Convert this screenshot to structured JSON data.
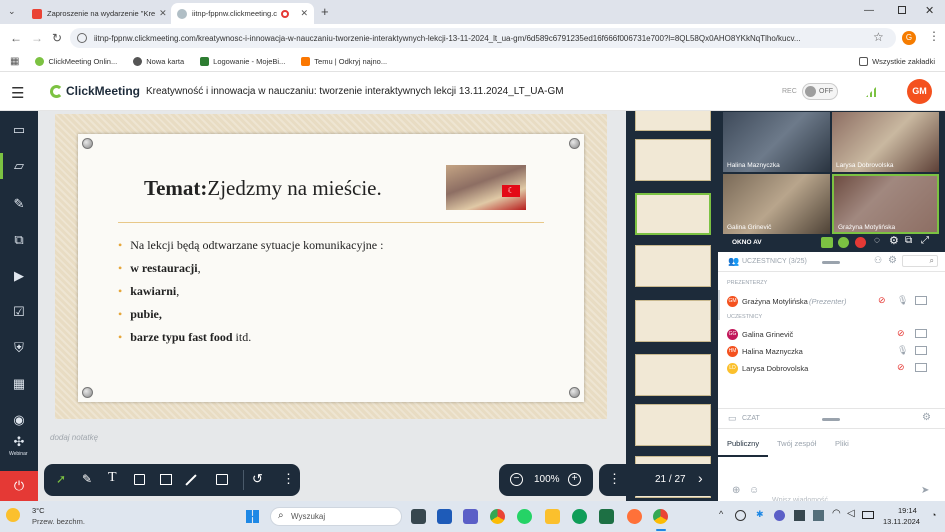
{
  "browser": {
    "tabs": [
      {
        "label": "Zaproszenie na wydarzenie \"Kre",
        "active": false
      },
      {
        "label": "iitnp-fppnw.clickmeeting.c",
        "active": true
      }
    ],
    "url": "iitnp-fppnw.clickmeeting.com/kreatywnosc-i-innowacja-w-nauczaniu-tworzenie-interaktywnych-lekcji-13-11-2024_lt_ua-gm/6d589c6791235ed16f666f006731e700?l=8QL58Qx0AHO8YKkNqTlho/kucv...",
    "bookmarks": [
      "ClickMeeting Onlin...",
      "Nowa karta",
      "Logowanie - MojeBi...",
      "Temu | Odkryj najno..."
    ],
    "all_bookmarks": "Wszystkie zakładki",
    "profile_initial": "G"
  },
  "app": {
    "logo": "ClickMeeting",
    "title": "Kreatywność i innowacja w nauczaniu: tworzenie interaktywnych lekcji 13.11.2024_LT_UA-GM",
    "rec_label": "REC",
    "rec_toggle": "OFF",
    "avatar": "GM"
  },
  "rail": {
    "webinar_label": "Webinar"
  },
  "slide": {
    "title_bold": "Temat:",
    "title_rest": "Zjedzmy na mieście.",
    "intro": "Na lekcji będą odtwarzane sytuacje komunikacyjne :",
    "items": [
      {
        "bold": "w restauracji",
        "rest": ","
      },
      {
        "bold": "kawiarni",
        "rest": ","
      },
      {
        "bold": "pubie,",
        "rest": ""
      },
      {
        "bold": "barze typu fast food",
        "rest": " itd."
      }
    ]
  },
  "notes_placeholder": "dodaj notatkę",
  "toolbar": {
    "zoom": "100%",
    "page": "21 / 27"
  },
  "video": {
    "tiles": [
      "Halina Maznyczka",
      "Larysa Dobrovolska",
      "Galina Grinevič",
      "Grażyna Motylińska"
    ],
    "section_label": "OKNO AV"
  },
  "participants": {
    "header": "UCZESTNICY (3/25)",
    "presenters_label": "PREZENTERZY",
    "participants_label": "UCZESTNICY",
    "presenter": {
      "initials": "GM",
      "name": "Grażyna Motylińska",
      "role": "(Prezenter)"
    },
    "list": [
      {
        "initials": "GG",
        "name": "Galina Grinevič",
        "color": "#c2185b"
      },
      {
        "initials": "HM",
        "name": "Halina Maznyczka",
        "color": "#f4511e"
      },
      {
        "initials": "LD",
        "name": "Larysa Dobrovolska",
        "color": "#fbc02d"
      }
    ]
  },
  "chat": {
    "header": "CZAT",
    "tabs": [
      "Publiczny",
      "Twój zespół",
      "Pliki"
    ],
    "input_placeholder": "Wpisz wiadomość..."
  },
  "taskbar": {
    "weather_temp": "3°C",
    "weather_desc": "Przew. bezchm.",
    "search_placeholder": "Wyszukaj",
    "time": "19:14",
    "date": "13.11.2024"
  }
}
